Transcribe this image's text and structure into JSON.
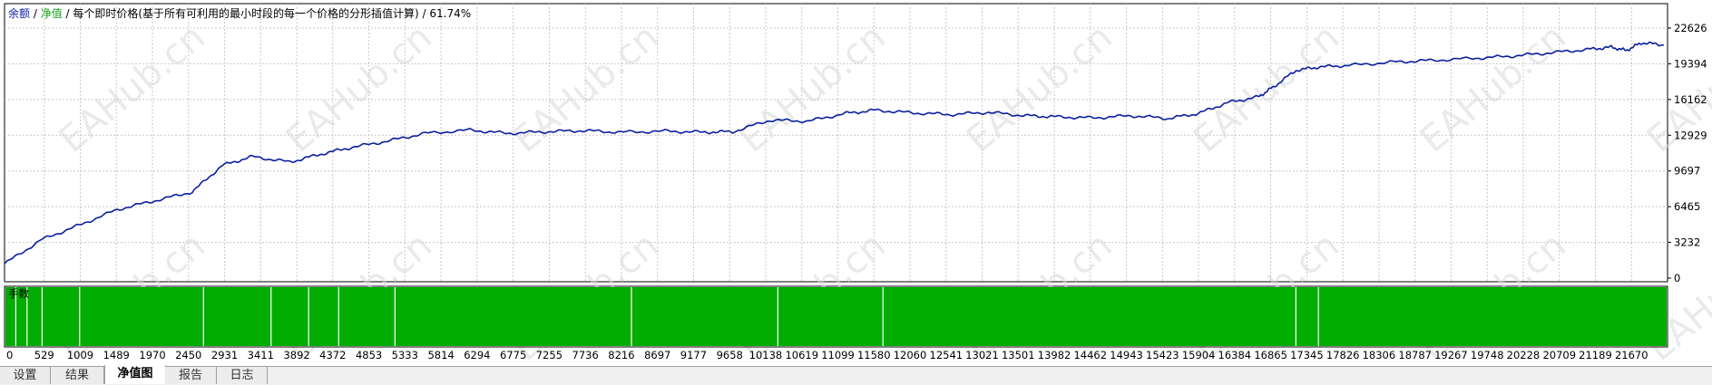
{
  "legend": {
    "balance": "余额",
    "slash1": " / ",
    "equity": "净值",
    "description": " / 每个即时价格(基于所有可利用的最小时段的每一个价格的分形插值计算) / 61.74%"
  },
  "lots_label": "手数",
  "watermark": "EAHub.cn",
  "tabs": [
    {
      "label": "设置",
      "active": false
    },
    {
      "label": "结果",
      "active": false
    },
    {
      "label": "净值图",
      "active": true
    },
    {
      "label": "报告",
      "active": false
    },
    {
      "label": "日志",
      "active": false
    }
  ],
  "colors": {
    "balance_line": "#0b1fa0",
    "lots_fill": "#00ad00",
    "grid": "#c8c8c8"
  },
  "chart_data": {
    "type": "line",
    "y_ticks": [
      "22626",
      "19394",
      "16162",
      "12929",
      "9697",
      "6465",
      "3232",
      "0"
    ],
    "y_tick_values": [
      22626,
      19394,
      16162,
      12929,
      9697,
      6465,
      3232,
      0
    ],
    "x_ticks": [
      "0",
      "529",
      "1009",
      "1489",
      "1970",
      "2450",
      "2931",
      "3411",
      "3892",
      "4372",
      "4853",
      "5333",
      "5814",
      "6294",
      "6775",
      "7255",
      "7736",
      "8216",
      "8697",
      "9177",
      "9658",
      "10138",
      "10619",
      "11099",
      "11580",
      "12060",
      "12541",
      "13021",
      "13501",
      "13982",
      "14462",
      "14943",
      "15423",
      "15904",
      "16384",
      "16865",
      "17345",
      "17826",
      "18306",
      "18787",
      "19267",
      "19748",
      "20228",
      "20709",
      "21189",
      "21670"
    ],
    "ylim": [
      0,
      22626
    ],
    "xlim": [
      0,
      22150
    ],
    "series": [
      {
        "x": [
          0,
          500,
          1000,
          1500,
          2000,
          2500,
          2900,
          3300,
          3800,
          4200,
          4600,
          5100,
          5600,
          6200,
          6700,
          7200,
          7700,
          8200,
          8800,
          9300,
          9700,
          10200,
          10700,
          11200,
          11600,
          12100,
          12600,
          13100,
          13600,
          14000,
          14500,
          15000,
          15500,
          15900,
          16300,
          16700,
          16900,
          17200,
          17500,
          17900,
          18500,
          19000,
          19600,
          20100,
          20600,
          21100,
          21400,
          21600,
          21800,
          22100
        ],
        "y": [
          1300,
          3500,
          4800,
          6200,
          7000,
          7800,
          10200,
          11000,
          10500,
          11200,
          11800,
          12400,
          13100,
          13400,
          13100,
          13250,
          13350,
          13200,
          13300,
          13200,
          13250,
          14300,
          14200,
          14900,
          15200,
          14950,
          14800,
          15000,
          14700,
          14600,
          14500,
          14700,
          14450,
          14900,
          15900,
          16400,
          17300,
          18800,
          19100,
          19250,
          19550,
          19700,
          19900,
          20100,
          20400,
          20700,
          20900,
          20600,
          21300,
          21100
        ]
      }
    ],
    "lots": {
      "label": "手数",
      "gap_x": [
        150,
        300,
        500,
        1000,
        2650,
        3550,
        4050,
        4450,
        5200,
        8350,
        10300,
        11700,
        17200,
        17500
      ]
    },
    "grid": true,
    "legend_position": "top-left"
  }
}
